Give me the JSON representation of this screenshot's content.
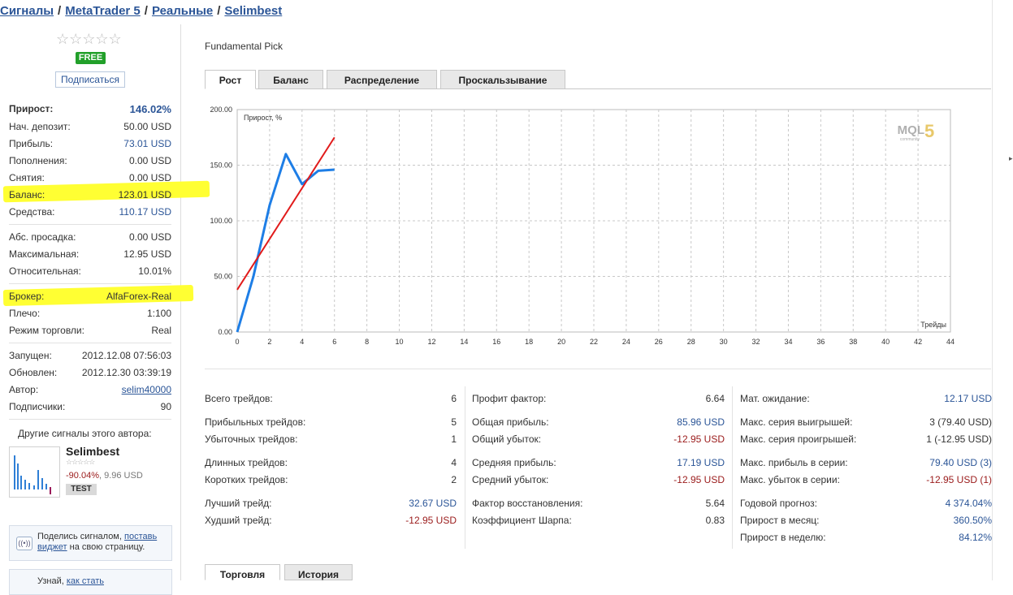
{
  "breadcrumbs": [
    {
      "label": "Сигналы",
      "link": true
    },
    {
      "label": "MetaTrader 5",
      "link": true
    },
    {
      "label": "Реальные",
      "link": true
    },
    {
      "label": "Selimbest",
      "link": true
    }
  ],
  "sidebar": {
    "stars": "☆☆☆☆☆",
    "free_badge": "FREE",
    "subscribe_label": "Подписаться",
    "stats": [
      {
        "label": "Прирост:",
        "value": "146.02%"
      },
      {
        "label": "Нач. депозит:",
        "value": "50.00 USD"
      },
      {
        "label": "Прибыль:",
        "value": "73.01 USD"
      },
      {
        "label": "Пополнения:",
        "value": "0.00 USD"
      },
      {
        "label": "Снятия:",
        "value": "0.00 USD"
      },
      {
        "label": "Баланс:",
        "value": "123.01 USD"
      },
      {
        "label": "Средства:",
        "value": "110.17 USD"
      },
      {
        "label": "Абс. просадка:",
        "value": "0.00 USD"
      },
      {
        "label": "Максимальная:",
        "value": "12.95 USD"
      },
      {
        "label": "Относительная:",
        "value": "10.01%"
      },
      {
        "label": "Брокер:",
        "value": "AlfaForex-Real"
      },
      {
        "label": "Плечо:",
        "value": "1:100"
      },
      {
        "label": "Режим торговли:",
        "value": "Real"
      },
      {
        "label": "Запущен:",
        "value": "2012.12.08 07:56:03"
      },
      {
        "label": "Обновлен:",
        "value": "2012.12.30 03:39:19"
      },
      {
        "label": "Автор:",
        "value": "selim40000"
      },
      {
        "label": "Подписчики:",
        "value": "90"
      }
    ],
    "other_signals_title": "Другие сигналы этого автора:",
    "other_signal": {
      "name": "Selimbest",
      "stars": "☆☆☆☆☆",
      "gain": "-90.04%",
      "balance": ", 9.96 USD",
      "badge": "TEST"
    },
    "share": {
      "icon": "((•))",
      "text_before": "Поделись сигналом, ",
      "link_text": "поставь виджет",
      "text_after": " на свою страницу."
    },
    "learn": {
      "text_before": "Узнай, ",
      "link_text": "как стать"
    }
  },
  "main": {
    "title": "Fundamental Pick",
    "tabs": [
      "Рост",
      "Баланс",
      "Распределение",
      "Проскальзывание"
    ],
    "bottom_tabs": [
      "Торговля",
      "История"
    ],
    "stats_col1": [
      {
        "label": "Всего трейдов:",
        "value": "6"
      },
      {
        "label": "Прибыльных трейдов:",
        "value": "5"
      },
      {
        "label": "Убыточных трейдов:",
        "value": "1"
      },
      {
        "label": "Длинных трейдов:",
        "value": "4"
      },
      {
        "label": "Коротких трейдов:",
        "value": "2"
      },
      {
        "label": "Лучший трейд:",
        "value": "32.67 USD"
      },
      {
        "label": "Худший трейд:",
        "value": "-12.95 USD"
      }
    ],
    "stats_col2": [
      {
        "label": "Профит фактор:",
        "value": "6.64"
      },
      {
        "label": "Общая прибыль:",
        "value": "85.96 USD"
      },
      {
        "label": "Общий убыток:",
        "value": "-12.95 USD"
      },
      {
        "label": "Средняя прибыль:",
        "value": "17.19 USD"
      },
      {
        "label": "Средний убыток:",
        "value": "-12.95 USD"
      },
      {
        "label": "Фактор восстановления:",
        "value": "5.64"
      },
      {
        "label": "Коэффициент Шарпа:",
        "value": "0.83"
      }
    ],
    "stats_col3": [
      {
        "label": "Мат. ожидание:",
        "value": "12.17 USD"
      },
      {
        "label": "Макс. серия выигрышей:",
        "value": "3 (79.40 USD)"
      },
      {
        "label": "Макс. серия проигрышей:",
        "value": "1 (-12.95 USD)"
      },
      {
        "label": "Макс. прибыль в серии:",
        "value": "79.40 USD (3)"
      },
      {
        "label": "Макс. убыток в серии:",
        "value": "-12.95 USD (1)"
      },
      {
        "label": "Годовой прогноз:",
        "value": "4 374.04%"
      },
      {
        "label": "Прирост в месяц:",
        "value": "360.50%"
      },
      {
        "label": "Прирост в неделю:",
        "value": "84.12%"
      }
    ]
  },
  "chart_data": {
    "type": "line",
    "ylabel": "Прирост, %",
    "xlabel": "Трейды",
    "watermark": "MQL5",
    "watermark_sub": "community",
    "xlim": [
      0,
      44
    ],
    "ylim": [
      0,
      200
    ],
    "x_ticks": [
      0,
      2,
      4,
      6,
      8,
      10,
      12,
      14,
      16,
      18,
      20,
      22,
      24,
      26,
      28,
      30,
      32,
      34,
      36,
      38,
      40,
      42,
      44
    ],
    "y_ticks": [
      "0.00",
      "50.00",
      "100.00",
      "150.00",
      "200.00"
    ],
    "series": [
      {
        "color": "#1e7ee6",
        "x": [
          0,
          1,
          2,
          3,
          4,
          5,
          6
        ],
        "values": [
          0,
          50,
          114,
          160,
          133,
          145,
          146
        ]
      },
      {
        "color": "#e11b1b",
        "x": [
          0,
          6
        ],
        "values": [
          38,
          175
        ]
      }
    ]
  }
}
